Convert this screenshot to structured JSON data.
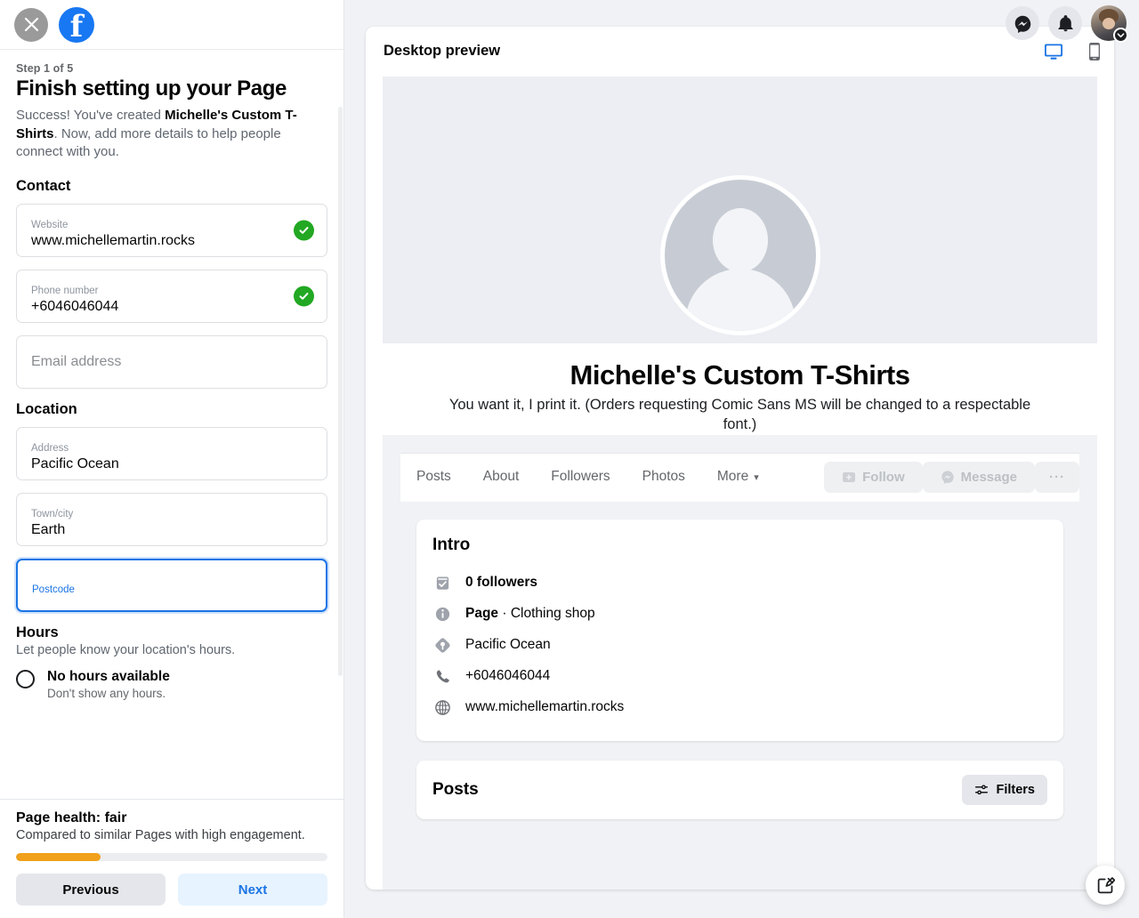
{
  "sidebar": {
    "close_label": "Close",
    "brand": "f",
    "step": "Step 1 of 5",
    "title": "Finish setting up your Page",
    "desc_part1": "Success! You've created ",
    "desc_bold": "Michelle's Custom T-Shirts",
    "desc_part2": ". Now, add more details to help people connect with you.",
    "contact_heading": "Contact",
    "location_heading": "Location",
    "fields": [
      {
        "label": "Website",
        "value": "www.michellemartin.rocks",
        "verified": true,
        "focused": false
      },
      {
        "label": "Phone number",
        "value": "+6046046044",
        "verified": true,
        "focused": false
      },
      {
        "label": "",
        "placeholder": "Email address",
        "value": "",
        "verified": false,
        "focused": false
      },
      {
        "label": "Address",
        "value": "Pacific Ocean",
        "verified": false,
        "focused": false
      },
      {
        "label": "Town/city",
        "value": "Earth",
        "verified": false,
        "focused": false
      },
      {
        "label": "Postcode",
        "value": "",
        "verified": false,
        "focused": true
      }
    ],
    "hours": {
      "heading": "Hours",
      "subtitle": "Let people know your location's hours.",
      "option_label": "No hours available",
      "option_sub": "Don't show any hours."
    },
    "footer": {
      "health_title": "Page health: fair",
      "health_sub": "Compared to similar Pages with high engagement.",
      "progress_percent": 27,
      "progress_color": "#f0a01a",
      "previous_label": "Previous",
      "next_label": "Next"
    }
  },
  "topbar": {
    "messenger_icon": "messenger-icon",
    "notifications_icon": "bell-icon",
    "account_icon": "avatar",
    "desktop_label": "Desktop preview mode",
    "mobile_label": "Mobile preview mode",
    "active_mode": "desktop",
    "desktop_active_color": "#1b74e4",
    "mobile_inactive_color": "#65676b"
  },
  "preview": {
    "header": "Desktop preview",
    "page_name": "Michelle's Custom T-Shirts",
    "tagline": "You want it, I print it. (Orders requesting Comic Sans MS will be changed to a respectable font.)",
    "tabs": [
      {
        "label": "Posts"
      },
      {
        "label": "About"
      },
      {
        "label": "Followers"
      },
      {
        "label": "Photos"
      },
      {
        "label": "More",
        "caret": "▾"
      }
    ],
    "actions": {
      "follow_label": "Follow",
      "message_label": "Message",
      "more_label": "···"
    },
    "intro": {
      "title": "Intro",
      "rows": [
        {
          "icon": "followers-icon",
          "text": "0 followers",
          "bold": true
        },
        {
          "icon": "info-icon",
          "bold_text": "Page",
          "text": " · Clothing shop"
        },
        {
          "icon": "location-pin-icon",
          "text": "Pacific Ocean"
        },
        {
          "icon": "phone-icon",
          "text": "+6046046044"
        },
        {
          "icon": "globe-icon",
          "text": "www.michellemartin.rocks"
        }
      ]
    },
    "posts": {
      "title": "Posts",
      "filters_label": "Filters"
    }
  },
  "fab": {
    "icon": "compose-icon"
  }
}
